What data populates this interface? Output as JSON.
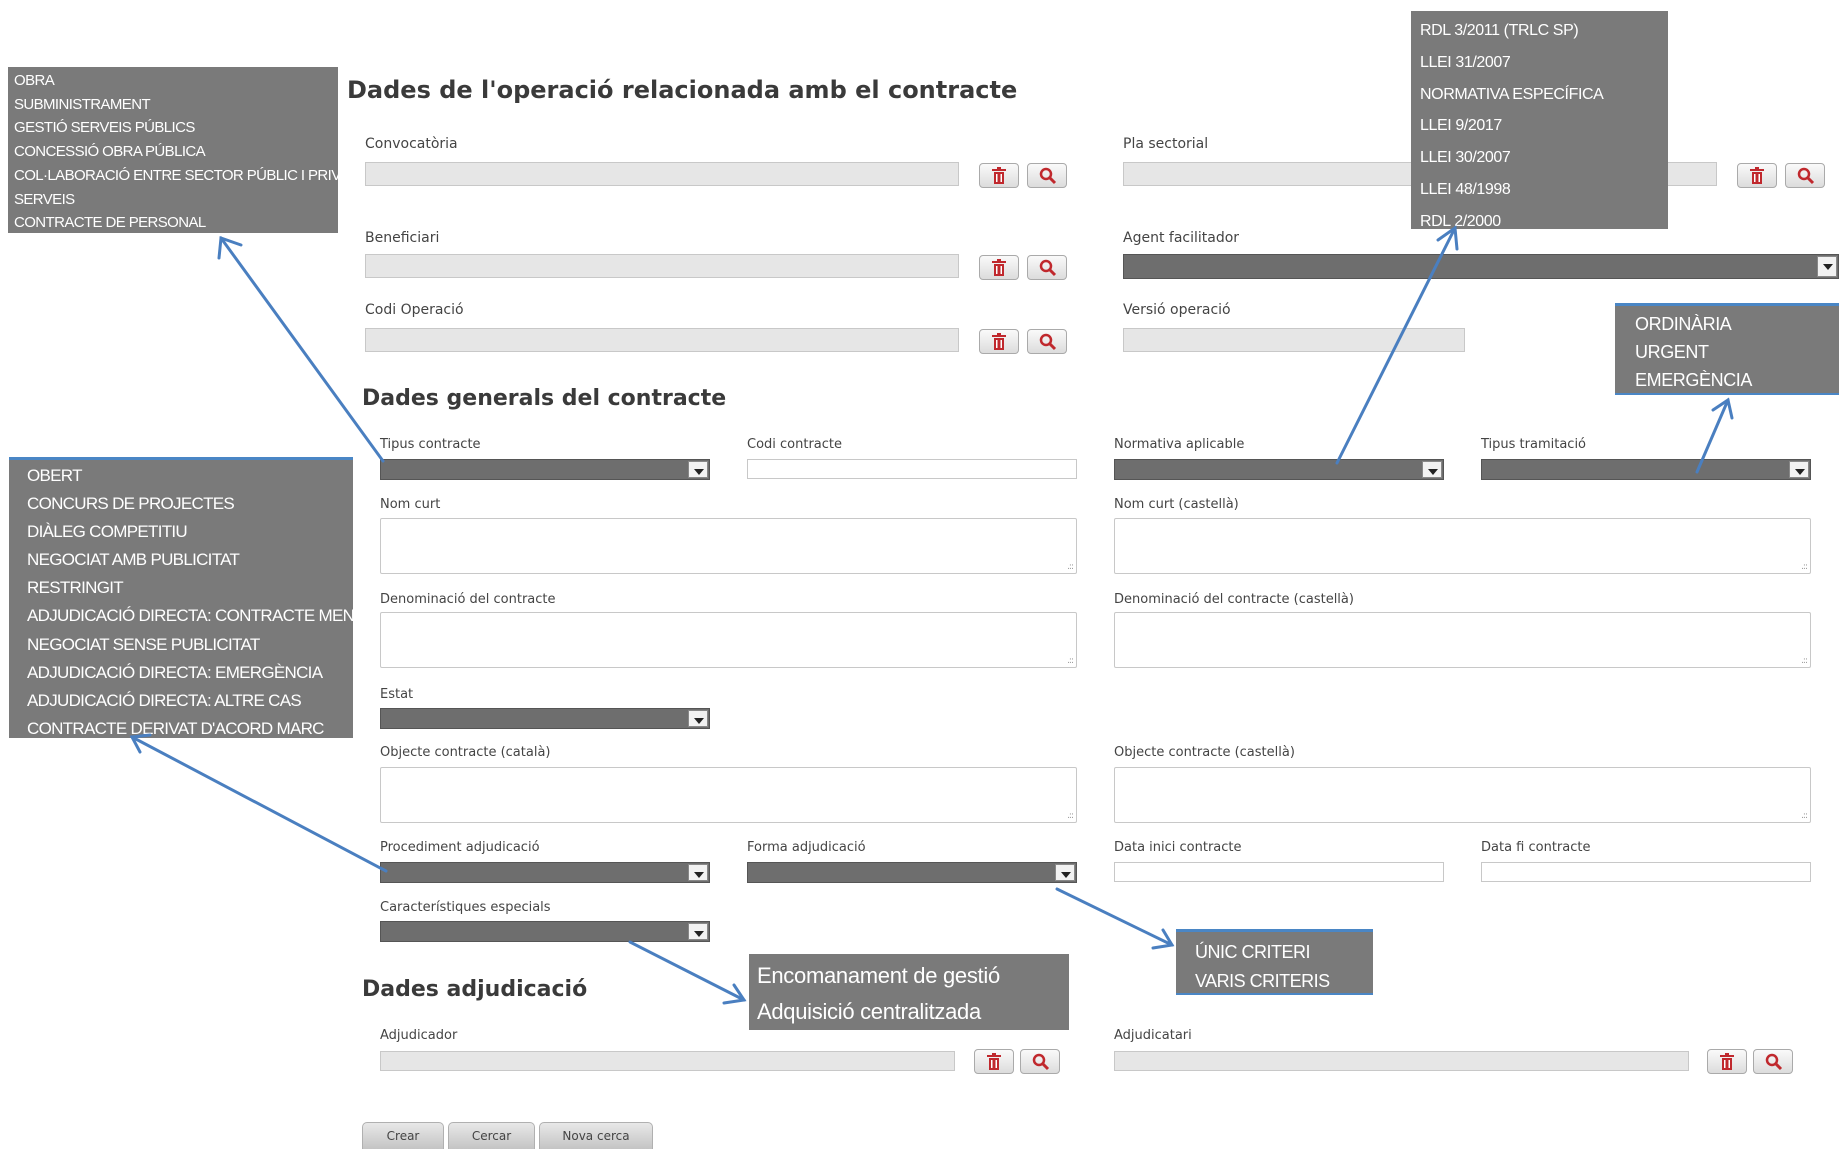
{
  "section_operation": {
    "title": "Dades de l'operació relacionada amb el contracte",
    "convocatoria_label": "Convocatòria",
    "pla_sectorial_label": "Pla sectorial",
    "beneficiari_label": "Beneficiari",
    "agent_facilitador_label": "Agent facilitador",
    "codi_operacio_label": "Codi Operació",
    "versio_operacio_label": "Versió operació"
  },
  "section_general": {
    "title": "Dades generals del contracte",
    "tipus_contracte_label": "Tipus contracte",
    "codi_contracte_label": "Codi contracte",
    "normativa_label": "Normativa aplicable",
    "tipus_tramitacio_label": "Tipus tramitació",
    "nom_curt_label": "Nom curt",
    "nom_curt_cast_label": "Nom curt (castellà)",
    "denominacio_label": "Denominació del contracte",
    "denominacio_cast_label": "Denominació del contracte (castellà)",
    "estat_label": "Estat",
    "objecte_cat_label": "Objecte contracte (català)",
    "objecte_cast_label": "Objecte contracte (castellà)",
    "procediment_label": "Procediment adjudicació",
    "forma_label": "Forma adjudicació",
    "data_inici_label": "Data inici contracte",
    "data_fi_label": "Data fi contracte",
    "caracteristiques_label": "Característiques especials"
  },
  "section_adjudicacio": {
    "title": "Dades adjudicació",
    "adjudicador_label": "Adjudicador",
    "adjudicatari_label": "Adjudicatari"
  },
  "actions": {
    "crear": "Crear",
    "cercar": "Cercar",
    "nova_cerca": "Nova cerca"
  },
  "popups": {
    "tipus_contracte": [
      "OBRA",
      "SUBMINISTRAMENT",
      "GESTIÓ SERVEIS PÚBLICS",
      "CONCESSIÓ OBRA PÚBLICA",
      "COL·LABORACIÓ ENTRE SECTOR PÚBLIC I PRIVAT",
      "SERVEIS",
      "CONTRACTE DE PERSONAL"
    ],
    "procediment": [
      "OBERT",
      "CONCURS DE PROJECTES",
      "DIÀLEG COMPETITIU",
      "NEGOCIAT AMB PUBLICITAT",
      "RESTRINGIT",
      "ADJUDICACIÓ DIRECTA: CONTRACTE MENOR",
      "NEGOCIAT SENSE PUBLICITAT",
      "ADJUDICACIÓ DIRECTA: EMERGÈNCIA",
      "ADJUDICACIÓ DIRECTA: ALTRE CAS",
      "CONTRACTE DERIVAT D'ACORD MARC"
    ],
    "normativa": [
      "RDL 3/2011 (TRLC SP)",
      "LLEI 31/2007",
      "NORMATIVA ESPECÍFICA",
      "LLEI 9/2017",
      "LLEI 30/2007",
      "LLEI 48/1998",
      "RDL 2/2000"
    ],
    "tramitacio": [
      "ORDINÀRIA",
      "URGENT",
      "EMERGÈNCIA"
    ],
    "forma": [
      "ÚNIC CRITERI",
      "VARIS CRITERIS"
    ],
    "caracteristiques": [
      "Encomanament de gestió",
      "Adquisició centralitzada"
    ]
  },
  "colors": {
    "arrow": "#4a7fc0",
    "popup_bg": "#7a7a7a",
    "select_bg": "#6e6e6e",
    "field_bg": "#e6e6e6",
    "icon_red": "#c0282d"
  },
  "icons": [
    "trash-icon",
    "search-icon",
    "chevron-down-icon"
  ]
}
